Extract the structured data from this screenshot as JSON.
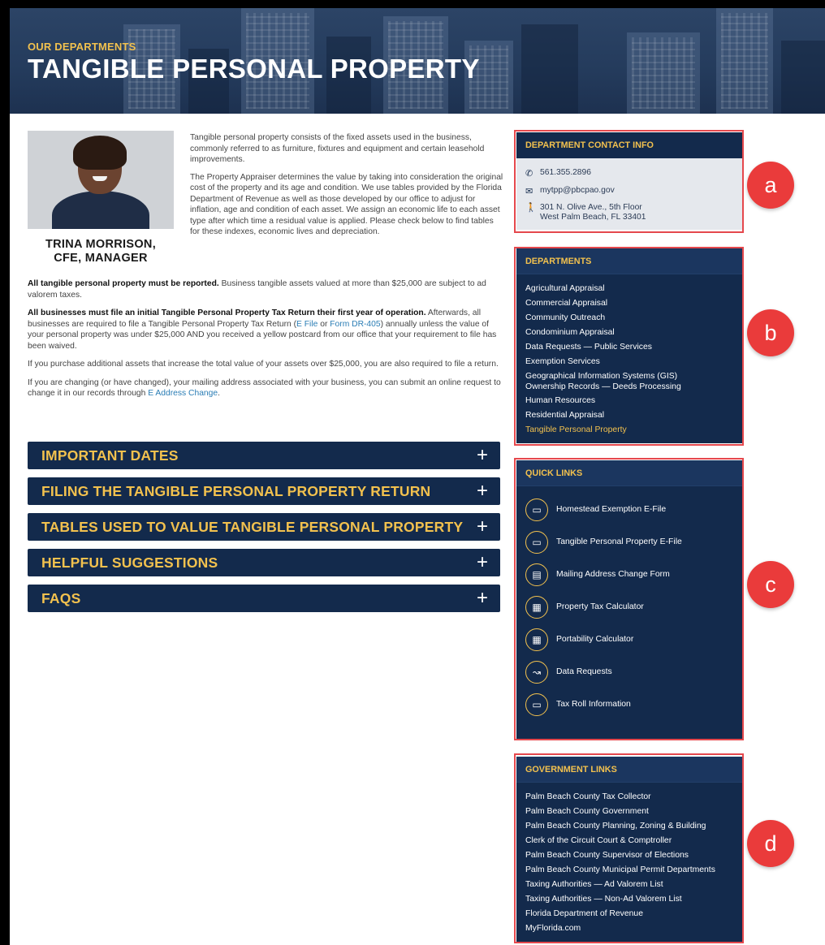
{
  "header": {
    "eyebrow": "OUR DEPARTMENTS",
    "title": "TANGIBLE PERSONAL PROPERTY"
  },
  "manager": {
    "name_line1": "TRINA MORRISON,",
    "name_line2": "CFE, MANAGER"
  },
  "intro": [
    "Tangible personal property consists of the fixed assets used in the business, commonly referred to as furniture, fixtures and equipment and certain leasehold improvements.",
    "The Property Appraiser determines the value by taking into consideration the original cost of the property and its age and condition. We use tables provided by the Florida Department of Revenue as well as those developed by our office to adjust for inflation, age and condition of each asset. We assign an economic life to each asset type after which time a residual value is applied. Please check below to find tables for these indexes, economic lives and depreciation."
  ],
  "content": {
    "p1_bold": "All tangible personal property must be reported.",
    "p1_rest": " Business tangible assets valued at more than $25,000 are subject to ad valorem taxes.",
    "p2_bold": "All businesses must file an initial Tangible Personal Property Tax Return their first year of operation.",
    "p2_a": " Afterwards, all businesses are required to file a Tangible Personal Property Tax Return (",
    "p2_link1": "E File",
    "p2_or": " or ",
    "p2_link2": "Form DR-405",
    "p2_b": ") annually unless the value of your personal property was under $25,000 AND you received a yellow postcard from our office that your requirement to file has been waived.",
    "p3": "If you purchase additional assets that increase the total value of your assets over $25,000, you are also required to file a return.",
    "p4_a": "If you are changing (or have changed), your mailing address associated with your business, you can submit an online request to change it in our records through ",
    "p4_link": "E Address Change",
    "p4_b": "."
  },
  "accordions": [
    {
      "label": "IMPORTANT DATES"
    },
    {
      "label": "FILING THE TANGIBLE PERSONAL PROPERTY RETURN"
    },
    {
      "label": "TABLES USED TO VALUE TANGIBLE PERSONAL PROPERTY"
    },
    {
      "label": "HELPFUL SUGGESTIONS"
    },
    {
      "label": "FAQS"
    }
  ],
  "contact": {
    "heading": "DEPARTMENT CONTACT INFO",
    "phone": "561.355.2896",
    "email": "mytpp@pbcpao.gov",
    "address_line1": "301 N. Olive Ave., 5th Floor",
    "address_line2": "West Palm Beach, FL 33401"
  },
  "departments": {
    "heading": "DEPARTMENTS",
    "items": [
      "Agricultural Appraisal",
      "Commercial Appraisal",
      "Community Outreach",
      "Condominium Appraisal",
      "Data Requests — Public Services",
      "Exemption Services",
      "Geographical Information Systems (GIS)",
      "Ownership Records — Deeds Processing",
      "Human Resources",
      "Residential Appraisal",
      "Tangible Personal Property"
    ]
  },
  "quick_links": {
    "heading": "QUICK LINKS",
    "items": [
      {
        "label": "Homestead Exemption E-File",
        "icon": "laptop-icon"
      },
      {
        "label": "Tangible Personal Property E-File",
        "icon": "laptop-icon"
      },
      {
        "label": "Mailing Address Change Form",
        "icon": "address-card-icon"
      },
      {
        "label": "Property Tax Calculator",
        "icon": "calculator-icon"
      },
      {
        "label": "Portability Calculator",
        "icon": "calculator-icon"
      },
      {
        "label": "Data Requests",
        "icon": "chart-search-icon"
      },
      {
        "label": "Tax Roll Information",
        "icon": "document-icon"
      }
    ]
  },
  "government_links": {
    "heading": "GOVERNMENT LINKS",
    "items": [
      "Palm Beach County Tax Collector",
      "Palm Beach County Government",
      "Palm Beach County Planning, Zoning & Building",
      "Clerk of the Circuit Court & Comptroller",
      "Palm Beach County Supervisor of Elections",
      "Palm Beach County Municipal Permit Departments",
      "Taxing Authorities — Ad Valorem List",
      "Taxing Authorities — Non-Ad Valorem List",
      "Florida Department of Revenue",
      "MyFlorida.com"
    ]
  },
  "annotations": {
    "a": "a",
    "b": "b",
    "c": "c",
    "d": "d",
    "outline_color": "#e5484d",
    "badge_color": "#ea3b3b"
  },
  "colors": {
    "navy": "#132a4c",
    "gold": "#f2c14e",
    "link": "#2a7db5"
  }
}
